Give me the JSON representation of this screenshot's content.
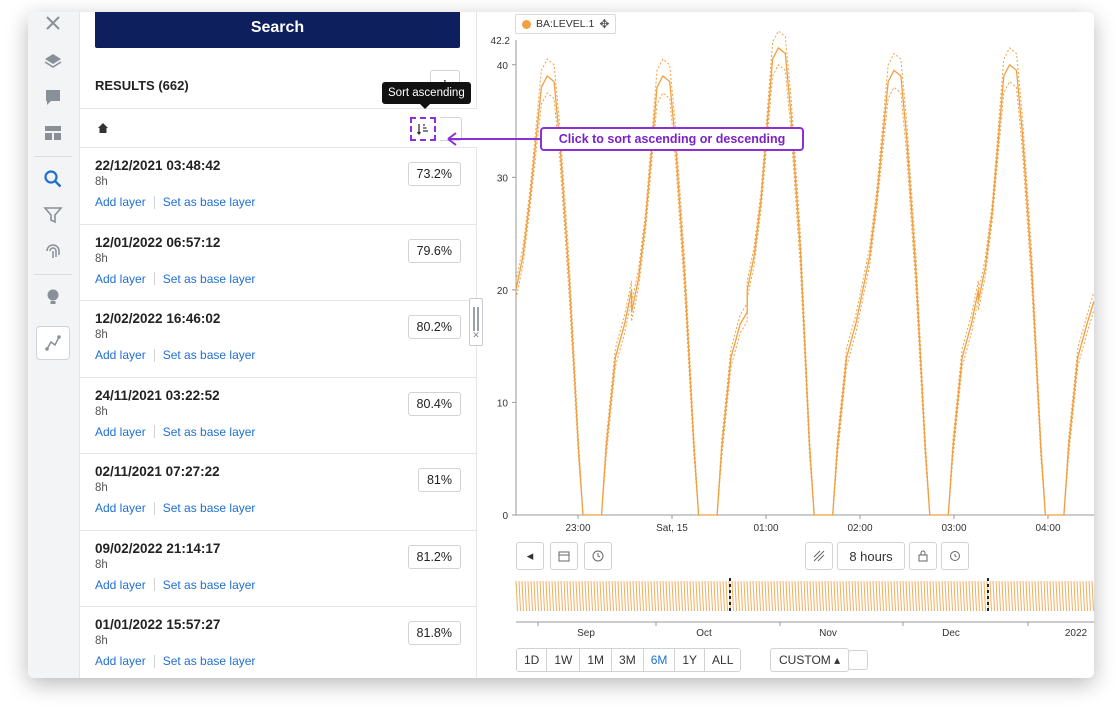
{
  "search": {
    "button_label": "Search"
  },
  "results": {
    "header": "RESULTS (662)",
    "more_label": "⋮",
    "tooltip": "Sort ascending",
    "items": [
      {
        "date": "22/12/2021 03:48:42",
        "duration": "8h",
        "score": "73.2%",
        "add": "Add layer",
        "base": "Set as base layer"
      },
      {
        "date": "12/01/2022 06:57:12",
        "duration": "8h",
        "score": "79.6%",
        "add": "Add layer",
        "base": "Set as base layer"
      },
      {
        "date": "12/02/2022 16:46:02",
        "duration": "8h",
        "score": "80.2%",
        "add": "Add layer",
        "base": "Set as base layer"
      },
      {
        "date": "24/11/2021 03:22:52",
        "duration": "8h",
        "score": "80.4%",
        "add": "Add layer",
        "base": "Set as base layer"
      },
      {
        "date": "02/11/2021 07:27:22",
        "duration": "8h",
        "score": "81%",
        "add": "Add layer",
        "base": "Set as base layer"
      },
      {
        "date": "09/02/2022 21:14:17",
        "duration": "8h",
        "score": "81.2%",
        "add": "Add layer",
        "base": "Set as base layer"
      },
      {
        "date": "01/01/2022 15:57:27",
        "duration": "8h",
        "score": "81.8%",
        "add": "Add layer",
        "base": "Set as base layer"
      }
    ]
  },
  "callout": {
    "text": "Click to sort ascending or descending",
    "color": "#8b2fd6"
  },
  "chart_header": {
    "legend": "BA:LEVEL.1",
    "color": "#f0a040"
  },
  "chart_controls": {
    "duration_label": "8 hours",
    "ranges": [
      "1D",
      "1W",
      "1M",
      "3M",
      "6M",
      "1Y",
      "ALL"
    ],
    "active_range": "6M",
    "custom_label": "CUSTOM ▴"
  },
  "chart_data": {
    "type": "line",
    "series": [
      {
        "name": "BA:LEVEL.1"
      }
    ],
    "y_ticks": [
      "0",
      "10",
      "20",
      "30",
      "40"
    ],
    "y_max_label": "42.2",
    "ylim": [
      0,
      42.2
    ],
    "x_ticks": [
      "23:00",
      "Sat, 15",
      "01:00",
      "02:00",
      "03:00",
      "04:00"
    ],
    "navigator_ticks": [
      "Sep",
      "Oct",
      "Nov",
      "Dec",
      "2022"
    ],
    "cycles": [
      {
        "rise_start": 20,
        "peak": 39,
        "low": 0
      },
      {
        "rise_start": 18,
        "peak": 39,
        "low": 0
      },
      {
        "rise_start": 20,
        "peak": 41.5,
        "low": 0
      },
      {
        "rise_start": 20,
        "peak": 39.5,
        "low": 0
      },
      {
        "rise_start": 19,
        "peak": 40,
        "low": 0
      }
    ]
  }
}
